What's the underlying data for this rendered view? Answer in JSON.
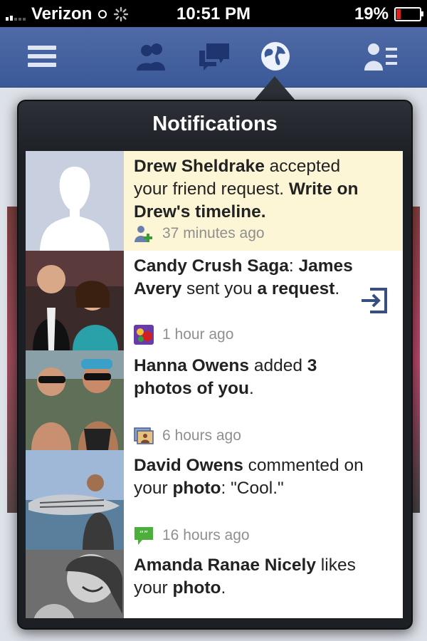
{
  "status_bar": {
    "carrier": "Verizon",
    "time": "10:51 PM",
    "battery": "19%",
    "battery_level": 0.19,
    "icons": [
      "signal-icon",
      "wifi-icon",
      "activity-spinner-icon",
      "battery-icon"
    ]
  },
  "navbar": {
    "items": [
      "menu-icon",
      "friend-requests-icon",
      "messages-icon",
      "notifications-globe-icon",
      "contacts-icon"
    ],
    "active": "notifications-globe-icon"
  },
  "popover": {
    "title": "Notifications"
  },
  "notifications": [
    {
      "parts": [
        {
          "t": "Drew Sheldrake",
          "b": true
        },
        {
          "t": " accepted your friend request. ",
          "b": false
        },
        {
          "t": "Write on Drew's timeline.",
          "b": true
        }
      ],
      "time": "37 minutes ago",
      "icon": "friend-added-icon",
      "unread": true
    },
    {
      "parts": [
        {
          "t": "Candy Crush Saga",
          "b": true
        },
        {
          "t": ": ",
          "b": false
        },
        {
          "t": "James Avery",
          "b": true
        },
        {
          "t": " sent you ",
          "b": false
        },
        {
          "t": "a request",
          "b": true
        },
        {
          "t": ".",
          "b": false
        }
      ],
      "time": "1 hour ago",
      "icon": "candy-crush-app-icon",
      "unread": false,
      "action": "open-request-icon"
    },
    {
      "parts": [
        {
          "t": "Hanna Owens",
          "b": true
        },
        {
          "t": " added ",
          "b": false
        },
        {
          "t": "3 photos of you",
          "b": true
        },
        {
          "t": ".",
          "b": false
        }
      ],
      "time": "6 hours ago",
      "icon": "photo-tag-icon",
      "unread": false
    },
    {
      "parts": [
        {
          "t": "David Owens",
          "b": true
        },
        {
          "t": " commented on your ",
          "b": false
        },
        {
          "t": "photo",
          "b": true
        },
        {
          "t": ": \"Cool.\"",
          "b": false
        }
      ],
      "time": "16 hours ago",
      "icon": "comment-icon",
      "unread": false
    },
    {
      "parts": [
        {
          "t": "Amanda Ranae Nicely",
          "b": true
        },
        {
          "t": " likes your ",
          "b": false
        },
        {
          "t": "photo",
          "b": true
        },
        {
          "t": ".",
          "b": false
        }
      ],
      "time": "",
      "icon": "",
      "unread": false
    }
  ],
  "colors": {
    "nav_blue": "#3b5998",
    "unread_bg": "#fcf6d6",
    "popover_dark": "#1c1f24",
    "battery_red": "#e0241b"
  }
}
